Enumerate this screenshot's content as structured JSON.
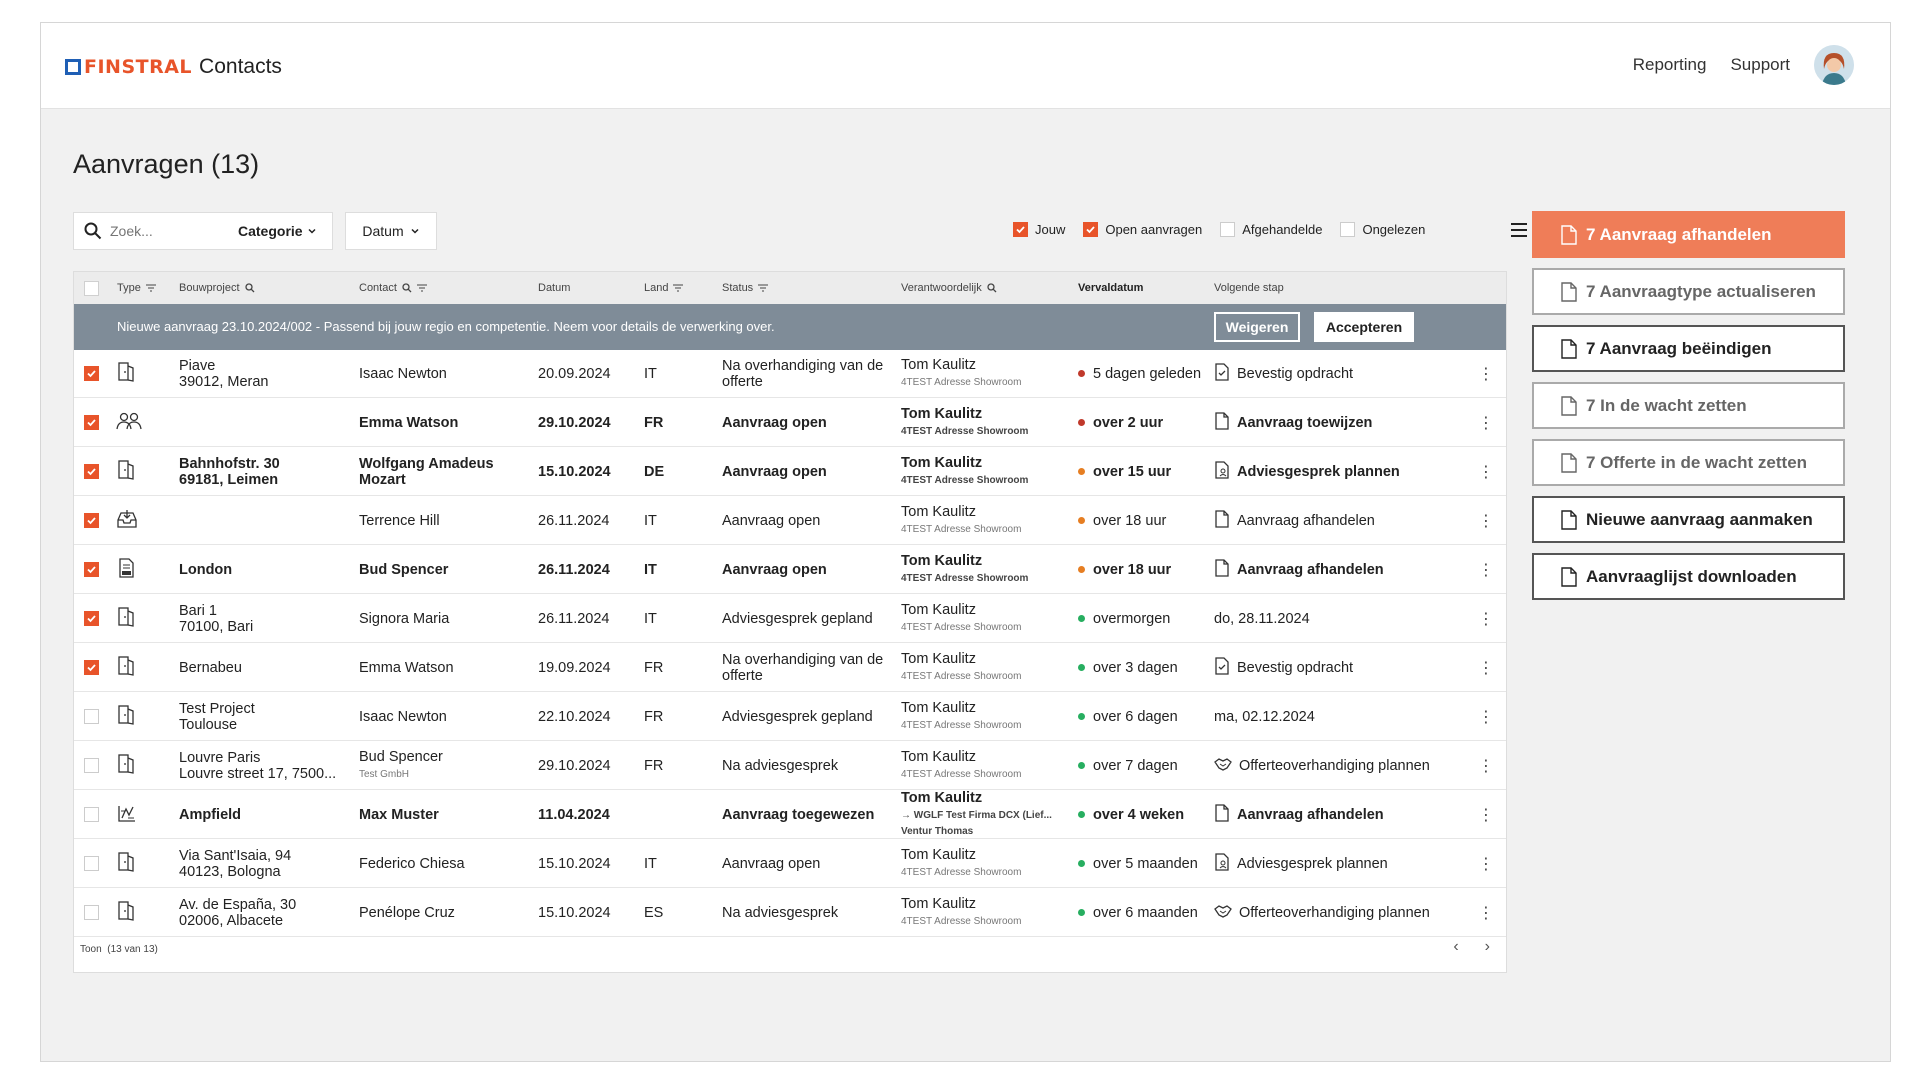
{
  "app": {
    "brand": "FINSTRAL",
    "name": "Contacts"
  },
  "nav": {
    "reporting": "Reporting",
    "support": "Support"
  },
  "page_title": "Aanvragen (13)",
  "toolbar": {
    "search_placeholder": "Zoek...",
    "category_label": "Categorie",
    "date_label": "Datum",
    "filters": [
      {
        "label": "Jouw",
        "checked": true
      },
      {
        "label": "Open aanvragen",
        "checked": true
      },
      {
        "label": "Afgehandelde",
        "checked": false
      },
      {
        "label": "Ongelezen",
        "checked": false
      }
    ]
  },
  "table": {
    "columns": [
      "Type",
      "Bouwproject",
      "Contact",
      "Datum",
      "Land",
      "Status",
      "Verantwoordelijk",
      "Vervaldatum",
      "Volgende stap"
    ],
    "banner": {
      "text": "Nieuwe aanvraag 23.10.2024/002 - Passend bij jouw regio en competentie. Neem voor details de verwerking over.",
      "reject": "Weigeren",
      "accept": "Accepteren"
    },
    "rows": [
      {
        "checked": true,
        "bold": false,
        "type_icon": "door-icon",
        "project1": "Piave",
        "project2": "39012, Meran",
        "contact": "Isaac Newton",
        "contact_sub": "",
        "date": "20.09.2024",
        "country": "IT",
        "status": "Na overhandiging van de offerte",
        "resp": "Tom Kaulitz",
        "resp_sub": "4TEST Adresse Showroom",
        "due": "5 dagen geleden",
        "due_color": "#c0392b",
        "next_icon": "document-check-icon",
        "next": "Bevestig opdracht"
      },
      {
        "checked": true,
        "bold": true,
        "type_icon": "people-icon",
        "project1": "",
        "project2": "",
        "contact": "Emma Watson",
        "contact_sub": "",
        "date": "29.10.2024",
        "country": "FR",
        "status": "Aanvraag open",
        "resp": "Tom Kaulitz",
        "resp_sub": "4TEST Adresse Showroom",
        "due": "over 2 uur",
        "due_color": "#c0392b",
        "next_icon": "document-icon",
        "next": "Aanvraag toewijzen"
      },
      {
        "checked": true,
        "bold": true,
        "type_icon": "door-icon",
        "project1": "Bahnhofstr. 30",
        "project2": "69181, Leimen",
        "contact": "Wolfgang Amadeus Mozart",
        "contact_sub": "",
        "date": "15.10.2024",
        "country": "DE",
        "status": "Aanvraag open",
        "resp": "Tom Kaulitz",
        "resp_sub": "4TEST Adresse Showroom",
        "due": "over 15 uur",
        "due_color": "#e67e22",
        "next_icon": "document-person-icon",
        "next": "Adviesgesprek plannen"
      },
      {
        "checked": true,
        "bold": false,
        "type_icon": "inbox-icon",
        "project1": "",
        "project2": "",
        "contact": "Terrence Hill",
        "contact_sub": "",
        "date": "26.11.2024",
        "country": "IT",
        "status": "Aanvraag open",
        "resp": "Tom Kaulitz",
        "resp_sub": "4TEST Adresse Showroom",
        "due": "over 18 uur",
        "due_color": "#e67e22",
        "next_icon": "document-icon",
        "next": "Aanvraag afhandelen"
      },
      {
        "checked": true,
        "bold": true,
        "type_icon": "dwg-file-icon",
        "project1": "London",
        "project2": "",
        "contact": "Bud Spencer",
        "contact_sub": "",
        "date": "26.11.2024",
        "country": "IT",
        "status": "Aanvraag open",
        "resp": "Tom Kaulitz",
        "resp_sub": "4TEST Adresse Showroom",
        "due": "over 18 uur",
        "due_color": "#e67e22",
        "next_icon": "document-icon",
        "next": "Aanvraag afhandelen"
      },
      {
        "checked": true,
        "bold": false,
        "type_icon": "door-icon",
        "project1": "Bari 1",
        "project2": "70100, Bari",
        "contact": "Signora Maria",
        "contact_sub": "",
        "date": "26.11.2024",
        "country": "IT",
        "status": "Adviesgesprek gepland",
        "resp": "Tom Kaulitz",
        "resp_sub": "4TEST Adresse Showroom",
        "due": "overmorgen",
        "due_color": "#27ae60",
        "next_icon": "",
        "next": "do, 28.11.2024"
      },
      {
        "checked": true,
        "bold": false,
        "type_icon": "door-icon",
        "project1": "Bernabeu",
        "project2": "",
        "contact": "Emma Watson",
        "contact_sub": "",
        "date": "19.09.2024",
        "country": "FR",
        "status": "Na overhandiging van de offerte",
        "resp": "Tom Kaulitz",
        "resp_sub": "4TEST Adresse Showroom",
        "due": "over 3 dagen",
        "due_color": "#27ae60",
        "next_icon": "document-check-icon",
        "next": "Bevestig opdracht"
      },
      {
        "checked": false,
        "bold": false,
        "type_icon": "door-icon",
        "project1": "Test Project",
        "project2": "Toulouse",
        "contact": "Isaac Newton",
        "contact_sub": "",
        "date": "22.10.2024",
        "country": "FR",
        "status": "Adviesgesprek gepland",
        "resp": "Tom Kaulitz",
        "resp_sub": "4TEST Adresse Showroom",
        "due": "over 6 dagen",
        "due_color": "#27ae60",
        "next_icon": "",
        "next": "ma, 02.12.2024"
      },
      {
        "checked": false,
        "bold": false,
        "type_icon": "door-icon",
        "project1": "Louvre Paris",
        "project2": "Louvre street 17, 7500...",
        "contact": "Bud Spencer",
        "contact_sub": "Test GmbH",
        "date": "29.10.2024",
        "country": "FR",
        "status": "Na adviesgesprek",
        "resp": "Tom Kaulitz",
        "resp_sub": "4TEST Adresse Showroom",
        "due": "over 7 dagen",
        "due_color": "#27ae60",
        "next_icon": "handshake-icon",
        "next": "Offerteoverhandiging plannen"
      },
      {
        "checked": false,
        "bold": true,
        "type_icon": "blueprint-icon",
        "project1": "Ampfield",
        "project2": "",
        "contact": "Max Muster",
        "contact_sub": "",
        "date": "11.04.2024",
        "country": "",
        "status": "Aanvraag toegewezen",
        "resp": "Tom Kaulitz",
        "resp_sub": "→ WGLF Test Firma DCX (Lief... Ventur Thomas",
        "due": "over 4 weken",
        "due_color": "#27ae60",
        "next_icon": "document-icon",
        "next": "Aanvraag afhandelen"
      },
      {
        "checked": false,
        "bold": false,
        "type_icon": "door-icon",
        "project1": "Via Sant'Isaia, 94",
        "project2": "40123, Bologna",
        "contact": "Federico Chiesa",
        "contact_sub": "",
        "date": "15.10.2024",
        "country": "IT",
        "status": "Aanvraag open",
        "resp": "Tom Kaulitz",
        "resp_sub": "4TEST Adresse Showroom",
        "due": "over 5 maanden",
        "due_color": "#27ae60",
        "next_icon": "document-person-icon",
        "next": "Adviesgesprek plannen"
      },
      {
        "checked": false,
        "bold": false,
        "type_icon": "door-icon",
        "project1": "Av. de España, 30",
        "project2": "02006, Albacete",
        "contact": "Penélope Cruz",
        "contact_sub": "",
        "date": "15.10.2024",
        "country": "ES",
        "status": "Na adviesgesprek",
        "resp": "Tom Kaulitz",
        "resp_sub": "4TEST Adresse Showroom",
        "due": "over 6 maanden",
        "due_color": "#27ae60",
        "next_icon": "handshake-icon",
        "next": "Offerteoverhandiging plannen"
      }
    ],
    "footer_show": "Toon",
    "footer_count": "(13 van 13)"
  },
  "actions": [
    {
      "label": "7 Aanvraag afhandelen",
      "style": "primary"
    },
    {
      "label": "7 Aanvraagtype actualiseren",
      "style": "disabled"
    },
    {
      "label": "7 Aanvraag beëindigen",
      "style": "normal"
    },
    {
      "label": "7 In de wacht zetten",
      "style": "disabled"
    },
    {
      "label": "7 Offerte in de wacht zetten",
      "style": "disabled"
    },
    {
      "label": "Nieuwe aanvraag aanmaken",
      "style": "normal"
    },
    {
      "label": "Aanvraaglijst downloaden",
      "style": "normal"
    }
  ],
  "colors": {
    "accent": "#e8542a",
    "banner": "#7f8c98",
    "button_primary": "#ef7d58"
  }
}
